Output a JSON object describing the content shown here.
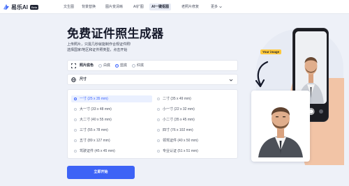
{
  "brand": {
    "name": "易乐AI",
    "badge": "Beta",
    "accent": "#3d63f6"
  },
  "nav": {
    "items": [
      "文生图",
      "背景替换",
      "图片变清晰",
      "AI扩图",
      "AI一键抠图",
      "老照片修复"
    ],
    "active_index": 4,
    "more_label": "更多"
  },
  "page": {
    "title": "免费证件照生成器",
    "intro_line1": "上传照片，只需几秒就能制作合规证件照!",
    "intro_line2": "选择国家/地区和证件照类型，点击开始"
  },
  "background_row": {
    "label": "照片底色",
    "options": [
      "白底",
      "蓝底",
      "红底"
    ],
    "selected": "蓝底"
  },
  "size_row": {
    "label": "尺寸"
  },
  "sizes": {
    "left": [
      "一寸 (25 x 35 mm)",
      "大一寸 (33 x 48 mm)",
      "大二寸 (40 x 55 mm)",
      "三寸 (55 x 78 mm)",
      "五寸 (89 x 127 mm)",
      "驾驶证件 (45 x 45 mm)"
    ],
    "right": [
      "二寸 (35 x 49 mm)",
      "小一寸 (22 x 32 mm)",
      "小二寸 (35 x 45 mm)",
      "四寸 (76 x 102 mm)",
      "领驾证件 (40 x 50 mm)",
      "专业认证 (51 x 51 mm)"
    ],
    "selected": "一寸 (25 x 35 mm)"
  },
  "cta": {
    "label": "立即开始"
  },
  "illustration": {
    "tag": "Your image",
    "tag_color": "#ffc93c"
  }
}
